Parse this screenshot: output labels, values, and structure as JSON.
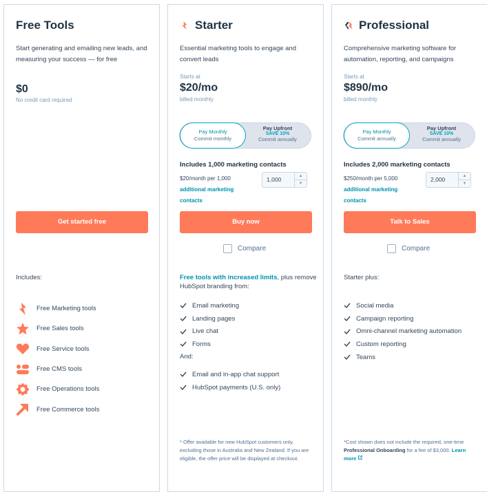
{
  "free": {
    "title": "Free Tools",
    "description": "Start generating and emailing new leads, and measuring your success — for free",
    "price": "$0",
    "price_note": "No credit card required",
    "cta": "Get started free",
    "includes_label": "Includes:",
    "tools": [
      {
        "label": "Free Marketing tools",
        "icon": "marketing-hub-icon"
      },
      {
        "label": "Free Sales tools",
        "icon": "sales-hub-icon"
      },
      {
        "label": "Free Service tools",
        "icon": "service-hub-icon"
      },
      {
        "label": "Free CMS tools",
        "icon": "cms-hub-icon"
      },
      {
        "label": "Free Operations tools",
        "icon": "operations-hub-icon"
      },
      {
        "label": "Free Commerce tools",
        "icon": "commerce-hub-icon"
      }
    ]
  },
  "starter": {
    "title": "Starter",
    "description": "Essential marketing tools to engage and convert leads",
    "starts_at": "Starts at",
    "price": "$20/mo",
    "billing": "billed monthly",
    "toggle": {
      "monthly_label": "Pay Monthly",
      "monthly_sub": "Commit monthly",
      "upfront_label": "Pay Upfront",
      "upfront_save": "SAVE 10%",
      "upfront_sub": "Commit annually"
    },
    "contacts_heading": "Includes 1,000 marketing contacts",
    "contacts_rate": "$20/month per 1,000",
    "contacts_link": "additional marketing contacts",
    "contacts_value": "1,000",
    "cta": "Buy now",
    "compare": "Compare",
    "includes_link": "Free tools with increased limits",
    "includes_rest": ", plus remove HubSpot branding from:",
    "features": [
      "Email marketing",
      "Landing pages",
      "Live chat",
      "Forms"
    ],
    "and_label": "And:",
    "extras": [
      "Email and in-app chat support",
      "HubSpot payments (U.S. only)"
    ],
    "footnote": "* Offer available for new HubSpot customers only, excluding those in Australia and New Zealand. If you are eligible, the offer price will be displayed at checkout."
  },
  "professional": {
    "title": "Professional",
    "description": "Comprehensive marketing software for automation, reporting, and campaigns",
    "starts_at": "Starts at",
    "price": "$890/mo",
    "billing": "billed monthly",
    "toggle": {
      "monthly_label": "Pay Monthly",
      "monthly_sub": "Commit annually",
      "upfront_label": "Pay Upfront",
      "upfront_save": "SAVE 10%",
      "upfront_sub": "Commit annually"
    },
    "contacts_heading": "Includes 2,000 marketing contacts",
    "contacts_rate": "$250/month per 5,000",
    "contacts_link": "additional marketing contacts",
    "contacts_value": "2,000",
    "cta": "Talk to Sales",
    "compare": "Compare",
    "includes_label": "Starter plus:",
    "features": [
      "Social media",
      "Campaign reporting",
      "Omni-channel marketing automation",
      "Custom reporting",
      "Teams"
    ],
    "footnote_pre": "*Cost shown does not include the required, one-time ",
    "footnote_bold": "Professional Onboarding",
    "footnote_mid": " for a fee of $3,000. ",
    "footnote_link": "Learn more"
  },
  "colors": {
    "accent": "#ff7a59",
    "link": "#0091ae",
    "text": "#33475b",
    "heading": "#213343",
    "border": "#cbd6e2"
  }
}
